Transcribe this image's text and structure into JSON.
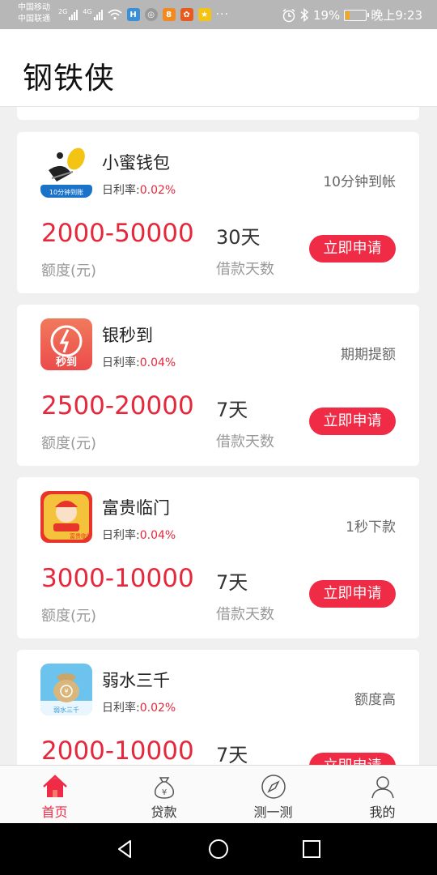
{
  "status": {
    "carrier1": "中国移动",
    "carrier2": "中国联通",
    "net1": "2G",
    "net2": "4G",
    "battery": "19%",
    "time": "晚上9:23",
    "more": "···"
  },
  "header": {
    "title": "钢铁侠"
  },
  "labels": {
    "rate_prefix": "日利率:",
    "amount_unit": "额度(元)",
    "days_unit": "借款天数",
    "apply": "立即申请"
  },
  "products": [
    {
      "name": "小蜜钱包",
      "rate": "0.02%",
      "feature": "10分钟到帐",
      "amount": "2000-50000",
      "days": "30天",
      "logo_text": "10分钟到账",
      "logo_color": "#1a73c9"
    },
    {
      "name": "银秒到",
      "rate": "0.04%",
      "feature": "期期提额",
      "amount": "2500-20000",
      "days": "7天",
      "logo_text": "秒到",
      "logo_color": "#ef5a4a"
    },
    {
      "name": "富贵临门",
      "rate": "0.04%",
      "feature": "1秒下款",
      "amount": "3000-10000",
      "days": "7天",
      "logo_text": "富贵临门",
      "logo_color": "#e8352a"
    },
    {
      "name": "弱水三千",
      "rate": "0.02%",
      "feature": "额度高",
      "amount": "2000-10000",
      "days": "7天",
      "logo_text": "弱水三千",
      "logo_color": "#4fb3e8"
    }
  ],
  "tabs": [
    {
      "label": "首页",
      "icon": "home-icon",
      "active": true
    },
    {
      "label": "贷款",
      "icon": "money-bag-icon",
      "active": false
    },
    {
      "label": "测一测",
      "icon": "compass-icon",
      "active": false
    },
    {
      "label": "我的",
      "icon": "user-icon",
      "active": false
    }
  ],
  "colors": {
    "accent": "#ef2b45",
    "amount": "#e5283c",
    "background": "#f0f0f0"
  }
}
